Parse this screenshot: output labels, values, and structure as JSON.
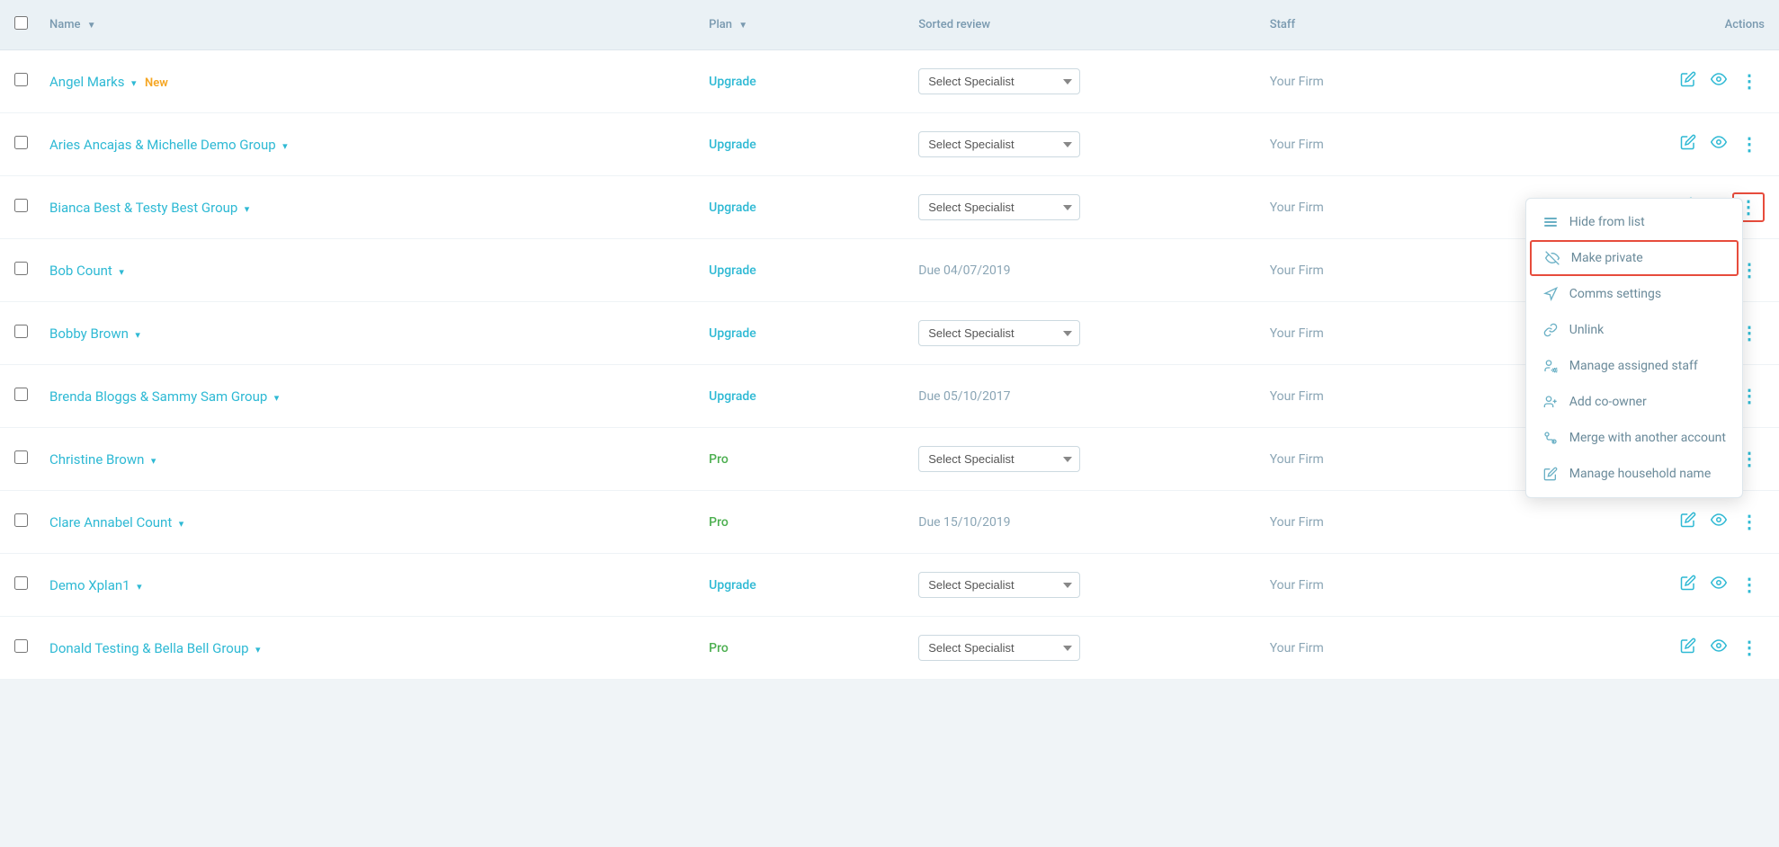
{
  "table": {
    "columns": {
      "name": "Name",
      "plan": "Plan",
      "review": "Sorted review",
      "staff": "Staff",
      "actions": "Actions"
    },
    "rows": [
      {
        "id": 1,
        "name": "Angel Marks",
        "badge": "New",
        "plan": "Upgrade",
        "plan_type": "upgrade",
        "review": "select",
        "staff": "Your Firm",
        "has_dropdown": true
      },
      {
        "id": 2,
        "name": "Aries Ancajas & Michelle Demo Group",
        "badge": "",
        "plan": "Upgrade",
        "plan_type": "upgrade",
        "review": "select",
        "staff": "Your Firm",
        "has_dropdown": true
      },
      {
        "id": 3,
        "name": "Bianca Best & Testy Best Group",
        "badge": "",
        "plan": "Upgrade",
        "plan_type": "upgrade",
        "review": "select",
        "staff": "Your Firm",
        "has_dropdown": true,
        "more_highlighted": true
      },
      {
        "id": 4,
        "name": "Bob Count",
        "badge": "",
        "plan": "Upgrade",
        "plan_type": "upgrade",
        "review": "Due 04/07/2019",
        "staff": "Your Firm",
        "has_dropdown": true
      },
      {
        "id": 5,
        "name": "Bobby Brown",
        "badge": "",
        "plan": "Upgrade",
        "plan_type": "upgrade",
        "review": "select",
        "staff": "Your Firm",
        "has_dropdown": true
      },
      {
        "id": 6,
        "name": "Brenda Bloggs & Sammy Sam Group",
        "badge": "",
        "plan": "Upgrade",
        "plan_type": "upgrade",
        "review": "Due 05/10/2017",
        "staff": "Your Firm",
        "has_dropdown": true
      },
      {
        "id": 7,
        "name": "Christine Brown",
        "badge": "",
        "plan": "Pro",
        "plan_type": "pro",
        "review": "select",
        "staff": "Your Firm",
        "has_dropdown": true
      },
      {
        "id": 8,
        "name": "Clare Annabel Count",
        "badge": "",
        "plan": "Pro",
        "plan_type": "pro",
        "review": "Due 15/10/2019",
        "staff": "Your Firm",
        "has_dropdown": true
      },
      {
        "id": 9,
        "name": "Demo Xplan1",
        "badge": "",
        "plan": "Upgrade",
        "plan_type": "upgrade",
        "review": "select",
        "staff": "Your Firm",
        "has_dropdown": true
      },
      {
        "id": 10,
        "name": "Donald Testing & Bella Bell Group",
        "badge": "",
        "plan": "Pro",
        "plan_type": "pro",
        "review": "select",
        "staff": "Your Firm",
        "has_dropdown": true
      }
    ],
    "specialist_placeholder": "Select Specialist"
  },
  "context_menu": {
    "items": [
      {
        "id": "hide",
        "label": "Hide from list",
        "icon": "list"
      },
      {
        "id": "private",
        "label": "Make private",
        "icon": "eye-off",
        "highlighted": true
      },
      {
        "id": "comms",
        "label": "Comms settings",
        "icon": "megaphone"
      },
      {
        "id": "unlink",
        "label": "Unlink",
        "icon": "link"
      },
      {
        "id": "staff",
        "label": "Manage assigned staff",
        "icon": "user-gear"
      },
      {
        "id": "coowner",
        "label": "Add co-owner",
        "icon": "user-plus"
      },
      {
        "id": "merge",
        "label": "Merge with another account",
        "icon": "merge"
      },
      {
        "id": "household",
        "label": "Manage household name",
        "icon": "edit-household"
      }
    ]
  }
}
